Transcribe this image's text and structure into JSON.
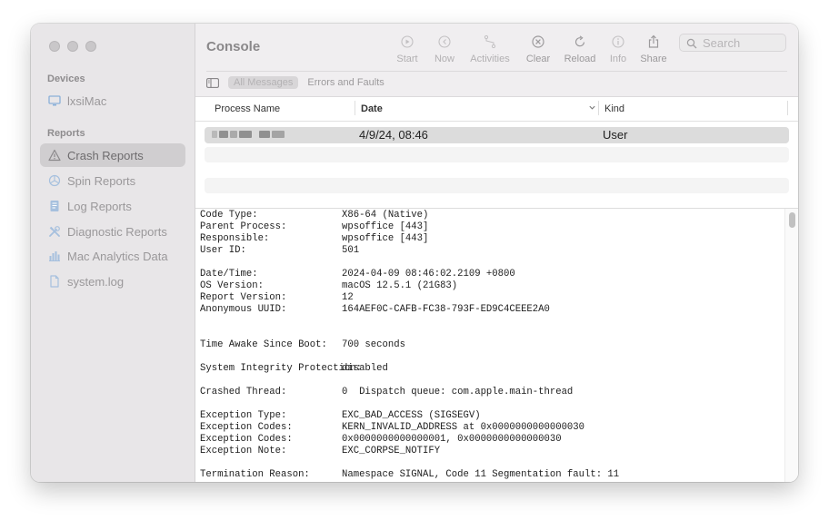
{
  "sidebar": {
    "devices_heading": "Devices",
    "device_name": "lxsiMac",
    "reports_heading": "Reports",
    "items": [
      {
        "label": "Crash Reports",
        "icon": "warning-triangle-icon",
        "selected": true
      },
      {
        "label": "Spin Reports",
        "icon": "spin-icon",
        "selected": false
      },
      {
        "label": "Log Reports",
        "icon": "document-icon",
        "selected": false
      },
      {
        "label": "Diagnostic Reports",
        "icon": "tools-icon",
        "selected": false
      },
      {
        "label": "Mac Analytics Data",
        "icon": "bar-chart-icon",
        "selected": false
      },
      {
        "label": "system.log",
        "icon": "file-icon",
        "selected": false
      }
    ]
  },
  "toolbar": {
    "title": "Console",
    "start": "Start",
    "now": "Now",
    "activities": "Activities",
    "clear": "Clear",
    "reload": "Reload",
    "info": "Info",
    "share": "Share",
    "search_placeholder": "Search",
    "filter_all": "All Messages",
    "filter_errors": "Errors and Faults"
  },
  "table": {
    "columns": {
      "process": "Process Name",
      "date": "Date",
      "kind": "Kind"
    },
    "rows": [
      {
        "process": "",
        "date": "4/9/24, 08:46",
        "kind": "User"
      }
    ]
  },
  "report": [
    {
      "key": "Code Type:",
      "value": "X86-64 (Native)"
    },
    {
      "key": "Parent Process:",
      "value": "wpsoffice [443]"
    },
    {
      "key": "Responsible:",
      "value": "wpsoffice [443]"
    },
    {
      "key": "User ID:",
      "value": "501"
    },
    {
      "key": "",
      "value": ""
    },
    {
      "key": "Date/Time:",
      "value": "2024-04-09 08:46:02.2109 +0800"
    },
    {
      "key": "OS Version:",
      "value": "macOS 12.5.1 (21G83)"
    },
    {
      "key": "Report Version:",
      "value": "12"
    },
    {
      "key": "Anonymous UUID:",
      "value": "164AEF0C-CAFB-FC38-793F-ED9C4CEEE2A0"
    },
    {
      "key": "",
      "value": ""
    },
    {
      "key": "",
      "value": ""
    },
    {
      "key": "Time Awake Since Boot:",
      "value": "700 seconds"
    },
    {
      "key": "",
      "value": ""
    },
    {
      "key": "System Integrity Protection:",
      "value": "disabled"
    },
    {
      "key": "",
      "value": ""
    },
    {
      "key": "Crashed Thread:",
      "value": "0  Dispatch queue: com.apple.main-thread"
    },
    {
      "key": "",
      "value": ""
    },
    {
      "key": "Exception Type:",
      "value": "EXC_BAD_ACCESS (SIGSEGV)"
    },
    {
      "key": "Exception Codes:",
      "value": "KERN_INVALID_ADDRESS at 0x0000000000000030"
    },
    {
      "key": "Exception Codes:",
      "value": "0x0000000000000001, 0x0000000000000030"
    },
    {
      "key": "Exception Note:",
      "value": "EXC_CORPSE_NOTIFY"
    },
    {
      "key": "",
      "value": ""
    },
    {
      "key": "Termination Reason:",
      "value": "Namespace SIGNAL, Code 11 Segmentation fault: 11"
    }
  ]
}
